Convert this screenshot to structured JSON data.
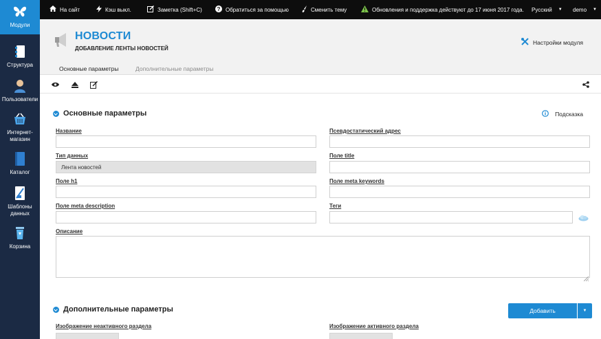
{
  "sidebar": {
    "items": [
      {
        "label": "Модули",
        "icon": "butterfly-icon"
      },
      {
        "label": "Структура",
        "icon": "structure-icon"
      },
      {
        "label": "Пользователи",
        "icon": "users-icon"
      },
      {
        "label": "Интернет-\nмагазин",
        "icon": "shop-basket-icon"
      },
      {
        "label": "Каталог",
        "icon": "catalog-book-icon"
      },
      {
        "label": "Шаблоны\nданных",
        "icon": "templates-icon"
      },
      {
        "label": "Корзина",
        "icon": "trash-icon"
      }
    ]
  },
  "topbar": {
    "site": "На сайт",
    "cache": "Кэш выкл.",
    "note": "Заметка (Shift+C)",
    "help": "Обратиться за помощью",
    "theme": "Сменить тему",
    "updates": "Обновления и поддержка действуют до 17 июня 2017 года.",
    "language": "Русский",
    "user": "demo"
  },
  "header": {
    "title": "НОВОСТИ",
    "subtitle": "ДОБАВЛЕНИЕ ЛЕНТЫ НОВОСТЕЙ",
    "module_settings": "Настройки модуля"
  },
  "tabs": {
    "main": "Основные параметры",
    "extra": "Дополнительные параметры"
  },
  "sections": {
    "main_title": "Основные параметры",
    "hint": "Подсказка",
    "extra_title": "Дополнительные параметры",
    "add_button": "Добавить"
  },
  "fields": {
    "name": {
      "label": "Название",
      "value": ""
    },
    "pseudo_address": {
      "label": "Псевдостатический адрес",
      "value": ""
    },
    "data_type": {
      "label": "Тип данных",
      "value": "Лента новостей"
    },
    "title_field": {
      "label": "Поле title",
      "value": ""
    },
    "h1": {
      "label": "Поле h1",
      "value": ""
    },
    "meta_keywords": {
      "label": "Поле meta keywords",
      "value": ""
    },
    "meta_description": {
      "label": "Поле meta description",
      "value": ""
    },
    "tags": {
      "label": "Теги",
      "value": ""
    },
    "description": {
      "label": "Описание",
      "value": ""
    },
    "inactive_image": {
      "label": "Изображение неактивного раздела"
    },
    "active_image": {
      "label": "Изображение активного раздела"
    }
  },
  "colors": {
    "accent": "#1e8ad3",
    "sidebar": "#1b2a44",
    "topbar": "#0d0d0d",
    "header_bg": "#f2f2f2"
  }
}
